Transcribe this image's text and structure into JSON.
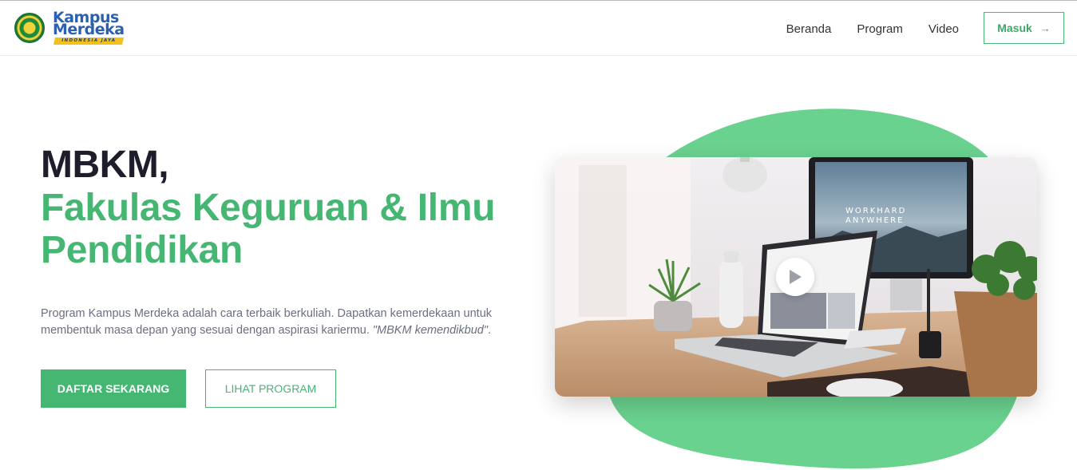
{
  "header": {
    "logo": {
      "line1": "Kampus",
      "line2": "Merdeka",
      "ribbon": "INDONESIA JAYA"
    },
    "nav": [
      {
        "label": "Beranda"
      },
      {
        "label": "Program"
      },
      {
        "label": "Video"
      }
    ],
    "login_label": "Masuk",
    "login_icon": "arrow-right-icon"
  },
  "hero": {
    "title_line1": "MBKM,",
    "title_line2": "Fakulas Keguruan & Ilmu",
    "title_line3": "Pendidikan",
    "description_main": "Program Kampus Merdeka adalah cara terbaik berkuliah. Dapatkan kemerdekaan untuk membentuk masa depan yang sesuai dengan aspirasi kariermu. ",
    "description_quote": "\"MBKM kemendikbud\"",
    "description_end": ".",
    "primary_button": "DAFTAR SEKARANG",
    "secondary_button": "LIHAT PROGRAM"
  },
  "video": {
    "monitor_text_1": "WORKHARD",
    "monitor_text_2": "ANYWHERE",
    "play_icon": "play-icon"
  },
  "colors": {
    "brand_green": "#46b673",
    "blob_green": "#6ad28f",
    "title_dark": "#1d1d2b",
    "text_muted": "#6b6f80"
  }
}
